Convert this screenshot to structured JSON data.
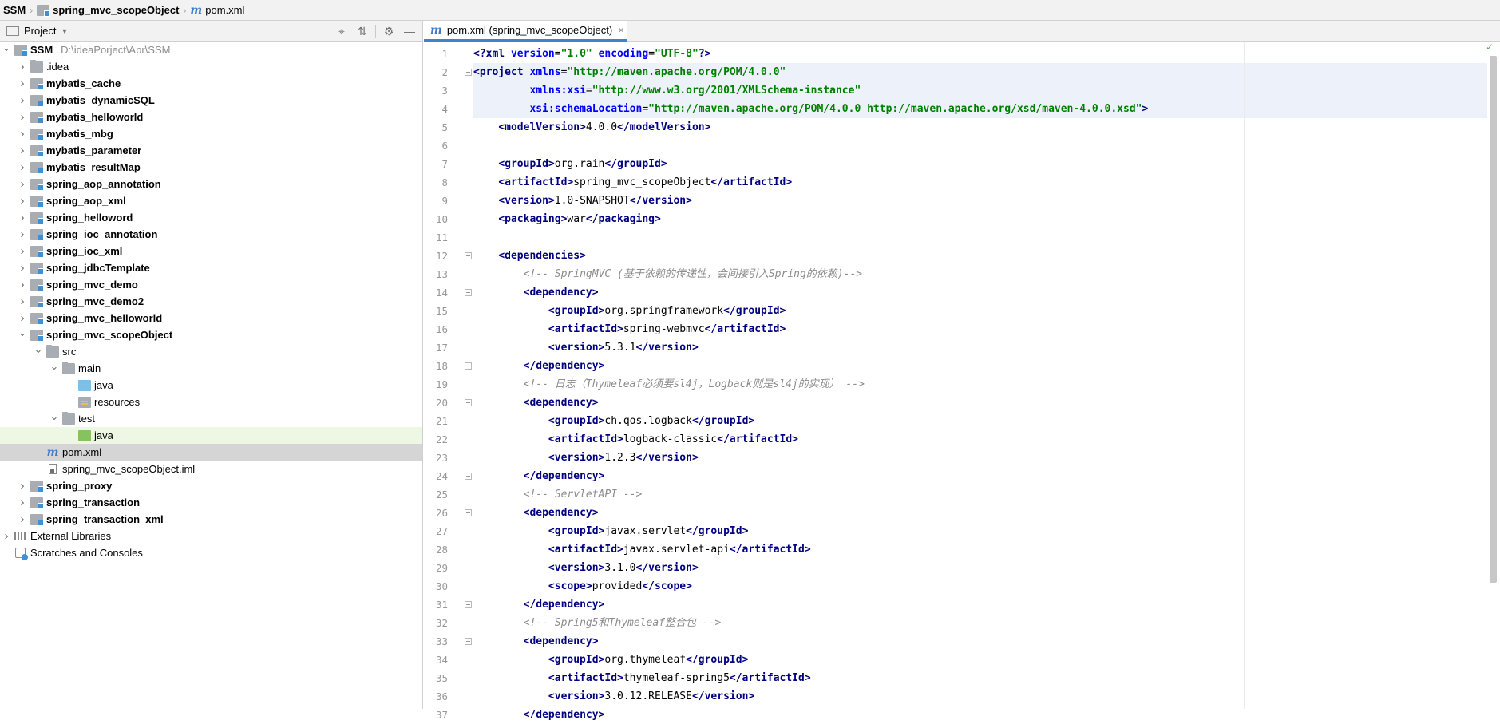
{
  "navbar": {
    "crumbs": [
      "SSM",
      "spring_mvc_scopeObject",
      "pom.xml"
    ]
  },
  "project_panel": {
    "title": "Project",
    "header_icons": [
      "crosshair-icon",
      "collapse-icon",
      "gear-icon",
      "minimize-icon"
    ],
    "tree": [
      {
        "label": "SSM",
        "path": "D:\\ideaPorject\\Apr\\SSM",
        "depth": 0,
        "expanded": true,
        "icon": "module-folder",
        "bold": true
      },
      {
        "label": ".idea",
        "depth": 1,
        "expanded": false,
        "icon": "folder",
        "bold": false
      },
      {
        "label": "mybatis_cache",
        "depth": 1,
        "expanded": false,
        "icon": "module-folder",
        "bold": true
      },
      {
        "label": "mybatis_dynamicSQL",
        "depth": 1,
        "expanded": false,
        "icon": "module-folder",
        "bold": true
      },
      {
        "label": "mybatis_helloworld",
        "depth": 1,
        "expanded": false,
        "icon": "module-folder",
        "bold": true
      },
      {
        "label": "mybatis_mbg",
        "depth": 1,
        "expanded": false,
        "icon": "module-folder",
        "bold": true
      },
      {
        "label": "mybatis_parameter",
        "depth": 1,
        "expanded": false,
        "icon": "module-folder",
        "bold": true
      },
      {
        "label": "mybatis_resultMap",
        "depth": 1,
        "expanded": false,
        "icon": "module-folder",
        "bold": true
      },
      {
        "label": "spring_aop_annotation",
        "depth": 1,
        "expanded": false,
        "icon": "module-folder",
        "bold": true
      },
      {
        "label": "spring_aop_xml",
        "depth": 1,
        "expanded": false,
        "icon": "module-folder",
        "bold": true
      },
      {
        "label": "spring_helloword",
        "depth": 1,
        "expanded": false,
        "icon": "module-folder",
        "bold": true
      },
      {
        "label": "spring_ioc_annotation",
        "depth": 1,
        "expanded": false,
        "icon": "module-folder",
        "bold": true
      },
      {
        "label": "spring_ioc_xml",
        "depth": 1,
        "expanded": false,
        "icon": "module-folder",
        "bold": true
      },
      {
        "label": "spring_jdbcTemplate",
        "depth": 1,
        "expanded": false,
        "icon": "module-folder",
        "bold": true
      },
      {
        "label": "spring_mvc_demo",
        "depth": 1,
        "expanded": false,
        "icon": "module-folder",
        "bold": true
      },
      {
        "label": "spring_mvc_demo2",
        "depth": 1,
        "expanded": false,
        "icon": "module-folder",
        "bold": true
      },
      {
        "label": "spring_mvc_helloworld",
        "depth": 1,
        "expanded": false,
        "icon": "module-folder",
        "bold": true
      },
      {
        "label": "spring_mvc_scopeObject",
        "depth": 1,
        "expanded": true,
        "icon": "module-folder",
        "bold": true
      },
      {
        "label": "src",
        "depth": 2,
        "expanded": true,
        "icon": "folder",
        "bold": false
      },
      {
        "label": "main",
        "depth": 3,
        "expanded": true,
        "icon": "folder",
        "bold": false
      },
      {
        "label": "java",
        "depth": 4,
        "expanded": null,
        "icon": "source-folder",
        "bold": false
      },
      {
        "label": "resources",
        "depth": 4,
        "expanded": null,
        "icon": "resources-folder",
        "bold": false
      },
      {
        "label": "test",
        "depth": 3,
        "expanded": true,
        "icon": "folder",
        "bold": false
      },
      {
        "label": "java",
        "depth": 4,
        "expanded": null,
        "icon": "test-folder",
        "bold": false,
        "state": "highlight"
      },
      {
        "label": "pom.xml",
        "depth": 2,
        "expanded": null,
        "icon": "maven-file",
        "bold": false,
        "state": "selected"
      },
      {
        "label": "spring_mvc_scopeObject.iml",
        "depth": 2,
        "expanded": null,
        "icon": "iml-file",
        "bold": false
      },
      {
        "label": "spring_proxy",
        "depth": 1,
        "expanded": false,
        "icon": "module-folder",
        "bold": true
      },
      {
        "label": "spring_transaction",
        "depth": 1,
        "expanded": false,
        "icon": "module-folder",
        "bold": true
      },
      {
        "label": "spring_transaction_xml",
        "depth": 1,
        "expanded": false,
        "icon": "module-folder",
        "bold": true
      },
      {
        "label": "External Libraries",
        "depth": 0,
        "expanded": false,
        "icon": "libraries",
        "bold": false
      },
      {
        "label": "Scratches and Consoles",
        "depth": 0,
        "expanded": null,
        "icon": "scratches",
        "bold": false
      }
    ]
  },
  "editor": {
    "tab": {
      "label": "pom.xml (spring_mvc_scopeObject)",
      "close": "×"
    },
    "lines": [
      {
        "n": "1",
        "tokens": [
          [
            "t",
            "<?"
          ],
          [
            "t",
            "xml "
          ],
          [
            "a",
            "version"
          ],
          [
            "x",
            "="
          ],
          [
            "v",
            "\"1.0\""
          ],
          [
            "x",
            " "
          ],
          [
            "a",
            "encoding"
          ],
          [
            "x",
            "="
          ],
          [
            "v",
            "\"UTF-8\""
          ],
          [
            "t",
            "?>"
          ]
        ]
      },
      {
        "n": "2",
        "fold": true,
        "hl": true,
        "tokens": [
          [
            "t",
            "<project "
          ],
          [
            "a",
            "xmlns"
          ],
          [
            "x",
            "="
          ],
          [
            "v",
            "\"http://maven.apache.org/POM/4.0.0\""
          ]
        ]
      },
      {
        "n": "3",
        "hl": true,
        "tokens": [
          [
            "x",
            "         "
          ],
          [
            "a",
            "xmlns:xsi"
          ],
          [
            "x",
            "="
          ],
          [
            "v",
            "\"http://www.w3.org/2001/XMLSchema-instance\""
          ]
        ]
      },
      {
        "n": "4",
        "hl": true,
        "tokens": [
          [
            "x",
            "         "
          ],
          [
            "a",
            "xsi:schemaLocation"
          ],
          [
            "x",
            "="
          ],
          [
            "v",
            "\"http://maven.apache.org/POM/4.0.0 http://maven.apache.org/xsd/maven-4.0.0.xsd\""
          ],
          [
            "t",
            ">"
          ]
        ]
      },
      {
        "n": "5",
        "tokens": [
          [
            "x",
            "    "
          ],
          [
            "t",
            "<modelVersion>"
          ],
          [
            "x",
            "4.0.0"
          ],
          [
            "t",
            "</modelVersion>"
          ]
        ]
      },
      {
        "n": "6",
        "tokens": []
      },
      {
        "n": "7",
        "tokens": [
          [
            "x",
            "    "
          ],
          [
            "t",
            "<groupId>"
          ],
          [
            "x",
            "org.rain"
          ],
          [
            "t",
            "</groupId>"
          ]
        ]
      },
      {
        "n": "8",
        "tokens": [
          [
            "x",
            "    "
          ],
          [
            "t",
            "<artifactId>"
          ],
          [
            "x",
            "spring_mvc_scopeObject"
          ],
          [
            "t",
            "</artifactId>"
          ]
        ]
      },
      {
        "n": "9",
        "tokens": [
          [
            "x",
            "    "
          ],
          [
            "t",
            "<version>"
          ],
          [
            "x",
            "1.0-SNAPSHOT"
          ],
          [
            "t",
            "</version>"
          ]
        ]
      },
      {
        "n": "10",
        "tokens": [
          [
            "x",
            "    "
          ],
          [
            "t",
            "<packaging>"
          ],
          [
            "x",
            "war"
          ],
          [
            "t",
            "</packaging>"
          ]
        ]
      },
      {
        "n": "11",
        "tokens": []
      },
      {
        "n": "12",
        "fold": true,
        "tokens": [
          [
            "x",
            "    "
          ],
          [
            "t",
            "<dependencies>"
          ]
        ]
      },
      {
        "n": "13",
        "tokens": [
          [
            "x",
            "        "
          ],
          [
            "c",
            "<!-- SpringMVC (基于依赖的传递性，会间接引入Spring的依赖)-->"
          ]
        ]
      },
      {
        "n": "14",
        "fold": true,
        "tokens": [
          [
            "x",
            "        "
          ],
          [
            "t",
            "<dependency>"
          ]
        ]
      },
      {
        "n": "15",
        "tokens": [
          [
            "x",
            "            "
          ],
          [
            "t",
            "<groupId>"
          ],
          [
            "x",
            "org.springframework"
          ],
          [
            "t",
            "</groupId>"
          ]
        ]
      },
      {
        "n": "16",
        "tokens": [
          [
            "x",
            "            "
          ],
          [
            "t",
            "<artifactId>"
          ],
          [
            "x",
            "spring-webmvc"
          ],
          [
            "t",
            "</artifactId>"
          ]
        ]
      },
      {
        "n": "17",
        "tokens": [
          [
            "x",
            "            "
          ],
          [
            "t",
            "<version>"
          ],
          [
            "x",
            "5.3.1"
          ],
          [
            "t",
            "</version>"
          ]
        ]
      },
      {
        "n": "18",
        "fold": true,
        "tokens": [
          [
            "x",
            "        "
          ],
          [
            "t",
            "</dependency>"
          ]
        ]
      },
      {
        "n": "19",
        "tokens": [
          [
            "x",
            "        "
          ],
          [
            "c",
            "<!-- 日志（Thymeleaf必须要sl4j，Logback则是sl4j的实现） -->"
          ]
        ]
      },
      {
        "n": "20",
        "fold": true,
        "tokens": [
          [
            "x",
            "        "
          ],
          [
            "t",
            "<dependency>"
          ]
        ]
      },
      {
        "n": "21",
        "tokens": [
          [
            "x",
            "            "
          ],
          [
            "t",
            "<groupId>"
          ],
          [
            "x",
            "ch.qos.logback"
          ],
          [
            "t",
            "</groupId>"
          ]
        ]
      },
      {
        "n": "22",
        "tokens": [
          [
            "x",
            "            "
          ],
          [
            "t",
            "<artifactId>"
          ],
          [
            "x",
            "logback-classic"
          ],
          [
            "t",
            "</artifactId>"
          ]
        ]
      },
      {
        "n": "23",
        "tokens": [
          [
            "x",
            "            "
          ],
          [
            "t",
            "<version>"
          ],
          [
            "x",
            "1.2.3"
          ],
          [
            "t",
            "</version>"
          ]
        ]
      },
      {
        "n": "24",
        "fold": true,
        "tokens": [
          [
            "x",
            "        "
          ],
          [
            "t",
            "</dependency>"
          ]
        ]
      },
      {
        "n": "25",
        "tokens": [
          [
            "x",
            "        "
          ],
          [
            "c",
            "<!-- ServletAPI -->"
          ]
        ]
      },
      {
        "n": "26",
        "fold": true,
        "tokens": [
          [
            "x",
            "        "
          ],
          [
            "t",
            "<dependency>"
          ]
        ]
      },
      {
        "n": "27",
        "tokens": [
          [
            "x",
            "            "
          ],
          [
            "t",
            "<groupId>"
          ],
          [
            "x",
            "javax.servlet"
          ],
          [
            "t",
            "</groupId>"
          ]
        ]
      },
      {
        "n": "28",
        "tokens": [
          [
            "x",
            "            "
          ],
          [
            "t",
            "<artifactId>"
          ],
          [
            "x",
            "javax.servlet-api"
          ],
          [
            "t",
            "</artifactId>"
          ]
        ]
      },
      {
        "n": "29",
        "tokens": [
          [
            "x",
            "            "
          ],
          [
            "t",
            "<version>"
          ],
          [
            "x",
            "3.1.0"
          ],
          [
            "t",
            "</version>"
          ]
        ]
      },
      {
        "n": "30",
        "tokens": [
          [
            "x",
            "            "
          ],
          [
            "t",
            "<scope>"
          ],
          [
            "x",
            "provided"
          ],
          [
            "t",
            "</scope>"
          ]
        ]
      },
      {
        "n": "31",
        "fold": true,
        "tokens": [
          [
            "x",
            "        "
          ],
          [
            "t",
            "</dependency>"
          ]
        ]
      },
      {
        "n": "32",
        "tokens": [
          [
            "x",
            "        "
          ],
          [
            "c",
            "<!-- Spring5和Thymeleaf整合包 -->"
          ]
        ]
      },
      {
        "n": "33",
        "fold": true,
        "tokens": [
          [
            "x",
            "        "
          ],
          [
            "t",
            "<dependency>"
          ]
        ]
      },
      {
        "n": "34",
        "tokens": [
          [
            "x",
            "            "
          ],
          [
            "t",
            "<groupId>"
          ],
          [
            "x",
            "org.thymeleaf"
          ],
          [
            "t",
            "</groupId>"
          ]
        ]
      },
      {
        "n": "35",
        "tokens": [
          [
            "x",
            "            "
          ],
          [
            "t",
            "<artifactId>"
          ],
          [
            "x",
            "thymeleaf-spring5"
          ],
          [
            "t",
            "</artifactId>"
          ]
        ]
      },
      {
        "n": "36",
        "tokens": [
          [
            "x",
            "            "
          ],
          [
            "t",
            "<version>"
          ],
          [
            "x",
            "3.0.12.RELEASE"
          ],
          [
            "t",
            "</version>"
          ]
        ]
      },
      {
        "n": "37",
        "tokens": [
          [
            "x",
            "        "
          ],
          [
            "t",
            "</dependency>"
          ]
        ]
      }
    ],
    "inspection_status": "✓"
  },
  "colors": {
    "tag": "#000080",
    "attribute": "#0000ff",
    "value": "#008000",
    "comment": "#8c8c8c",
    "selected_row": "#d5d5d5",
    "highlight_row": "#eef7e4",
    "tab_underline": "#4083c9"
  }
}
